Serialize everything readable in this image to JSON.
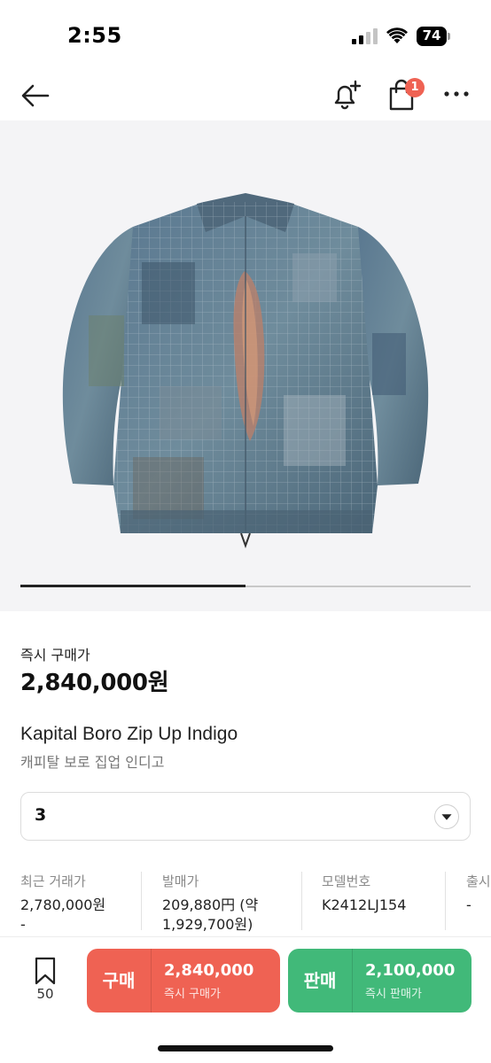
{
  "status_bar": {
    "time": "2:55",
    "battery": "74",
    "icons": [
      "signal-icon",
      "wifi-icon",
      "battery-icon"
    ]
  },
  "nav": {
    "icons": [
      "back-arrow-icon",
      "bell-plus-icon",
      "shopping-bag-icon",
      "more-icon"
    ],
    "cart_badge": "1"
  },
  "product": {
    "image_alt": "Kapital Boro Zip Up jacket",
    "gallery_progress": 0.5,
    "price_label": "즉시 구매가",
    "price": "2,840,000원",
    "name": "Kapital Boro Zip Up Indigo",
    "name_ko": "캐피탈 보로 집업 인디고"
  },
  "size_select": {
    "value": "3",
    "icon": "chevron-down-icon"
  },
  "info": [
    {
      "label": "최근 거래가",
      "value": "2,780,000원\n-"
    },
    {
      "label": "발매가",
      "value": "209,880円 (약\n1,929,700원)"
    },
    {
      "label": "모델번호",
      "value": "K2412LJ154"
    },
    {
      "label": "출시",
      "value": "-"
    }
  ],
  "bottom_bar": {
    "wish_count": "50",
    "buy": {
      "label": "구매",
      "price": "2,840,000",
      "sub": "즉시 구매가",
      "color": "#ef6253"
    },
    "sell": {
      "label": "판매",
      "price": "2,100,000",
      "sub": "즉시 판매가",
      "color": "#41b979"
    }
  }
}
